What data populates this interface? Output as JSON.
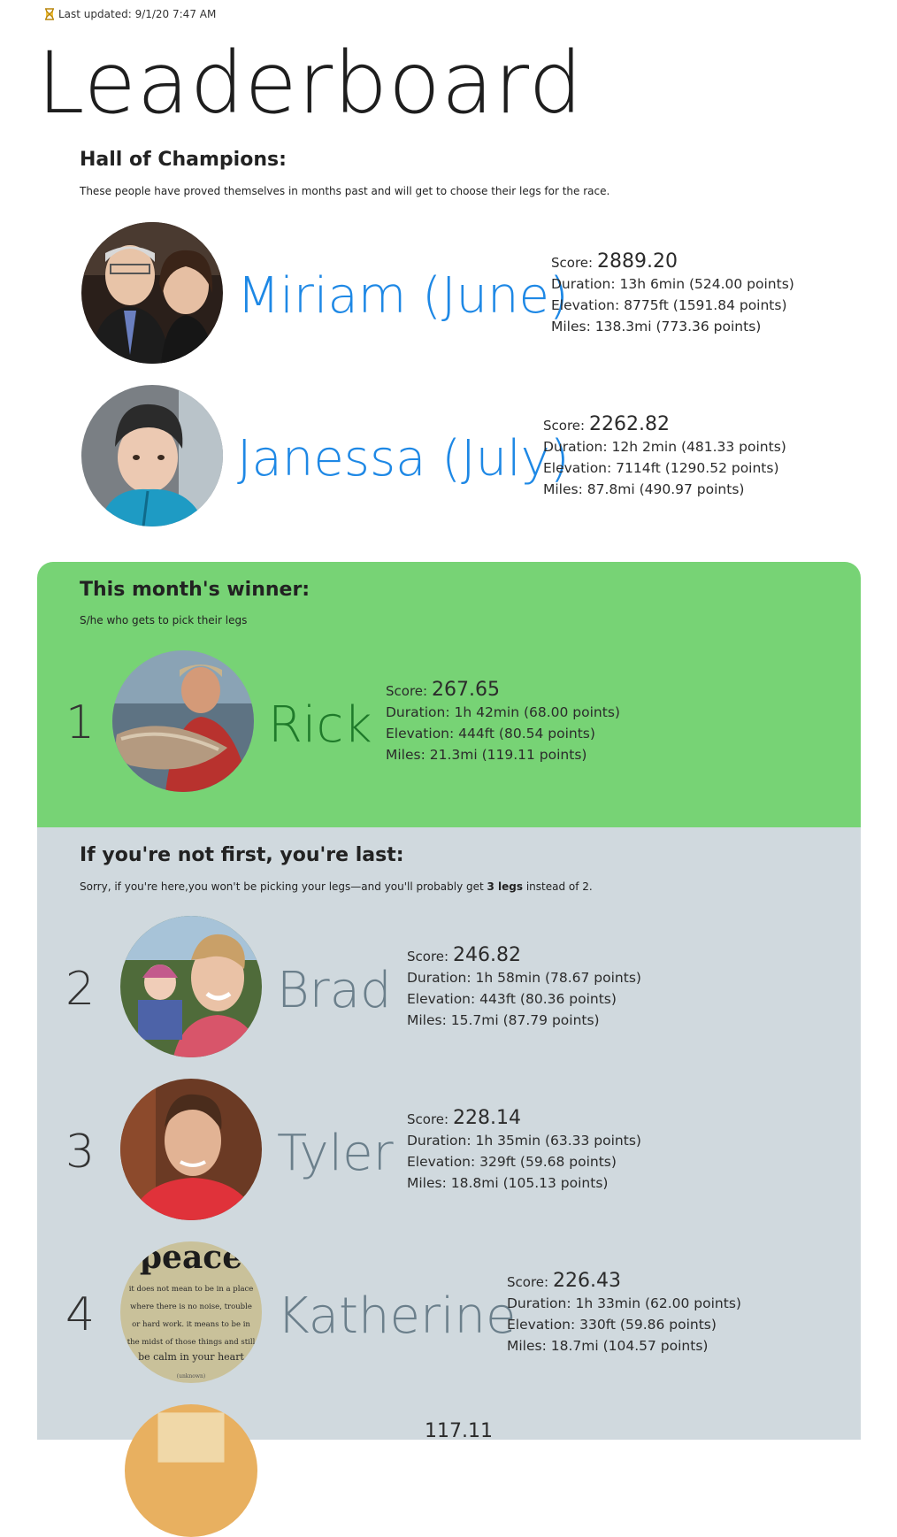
{
  "header": {
    "last_updated": "Last updated: 9/1/20 7:47 AM",
    "title": "Leaderboard"
  },
  "hall": {
    "heading": "Hall of Champions:",
    "subtitle": "These people have proved themselves in months past and will get to choose their legs for the race.",
    "entries": [
      {
        "name": "Miriam (June)",
        "score_label": "Score:",
        "score": "2889.20",
        "duration": "Duration: 13h 6min (524.00 points)",
        "elevation": "Elevation: 8775ft (1591.84 points)",
        "miles": "Miles: 138.3mi (773.36 points)"
      },
      {
        "name": "Janessa (July)",
        "score_label": "Score:",
        "score": "2262.82",
        "duration": "Duration: 12h 2min (481.33 points)",
        "elevation": "Elevation: 7114ft (1290.52 points)",
        "miles": "Miles: 87.8mi (490.97 points)"
      }
    ]
  },
  "winner": {
    "heading": "This month's winner:",
    "subtitle": "S/he who gets to pick their legs",
    "entry": {
      "rank": "1",
      "name": "Rick",
      "score_label": "Score:",
      "score": "267.65",
      "duration": "Duration: 1h 42min (68.00 points)",
      "elevation": "Elevation: 444ft (80.54 points)",
      "miles": "Miles: 21.3mi (119.11 points)"
    }
  },
  "others": {
    "heading": "If you're not first, you're last:",
    "subtitle_pre": "Sorry, if you're here,you won't be picking your legs—and you'll probably get ",
    "subtitle_bold": "3 legs",
    "subtitle_post": " instead of 2.",
    "entries": [
      {
        "rank": "2",
        "name": "Brad",
        "score_label": "Score:",
        "score": "246.82",
        "duration": "Duration: 1h 58min (78.67 points)",
        "elevation": "Elevation: 443ft (80.36 points)",
        "miles": "Miles: 15.7mi (87.79 points)"
      },
      {
        "rank": "3",
        "name": "Tyler",
        "score_label": "Score:",
        "score": "228.14",
        "duration": "Duration: 1h 35min (63.33 points)",
        "elevation": "Elevation: 329ft (59.68 points)",
        "miles": "Miles: 18.8mi (105.13 points)"
      },
      {
        "rank": "4",
        "name": "Katherine",
        "score_label": "Score:",
        "score": "226.43",
        "duration": "Duration: 1h 33min (62.00 points)",
        "elevation": "Elevation: 330ft (59.86 points)",
        "miles": "Miles: 18.7mi (104.57 points)"
      }
    ],
    "partial_score": "117.11"
  },
  "photo_text": {
    "katherine_word": "peace",
    "katherine_lines": [
      "it does not mean to be in a place",
      "where there is no noise, trouble",
      "or hard work. it means to be in",
      "the midst of those things and still",
      "be calm in your heart"
    ],
    "katherine_credit": "(unknown)"
  },
  "icons": {
    "updated": "hourglass-icon"
  },
  "colors": {
    "winner_bg": "#77d375",
    "others_bg": "#d0d9de",
    "champion_name": "#1e88e5",
    "winner_name": "#1f7a2a",
    "other_name": "#6b7f8b"
  }
}
